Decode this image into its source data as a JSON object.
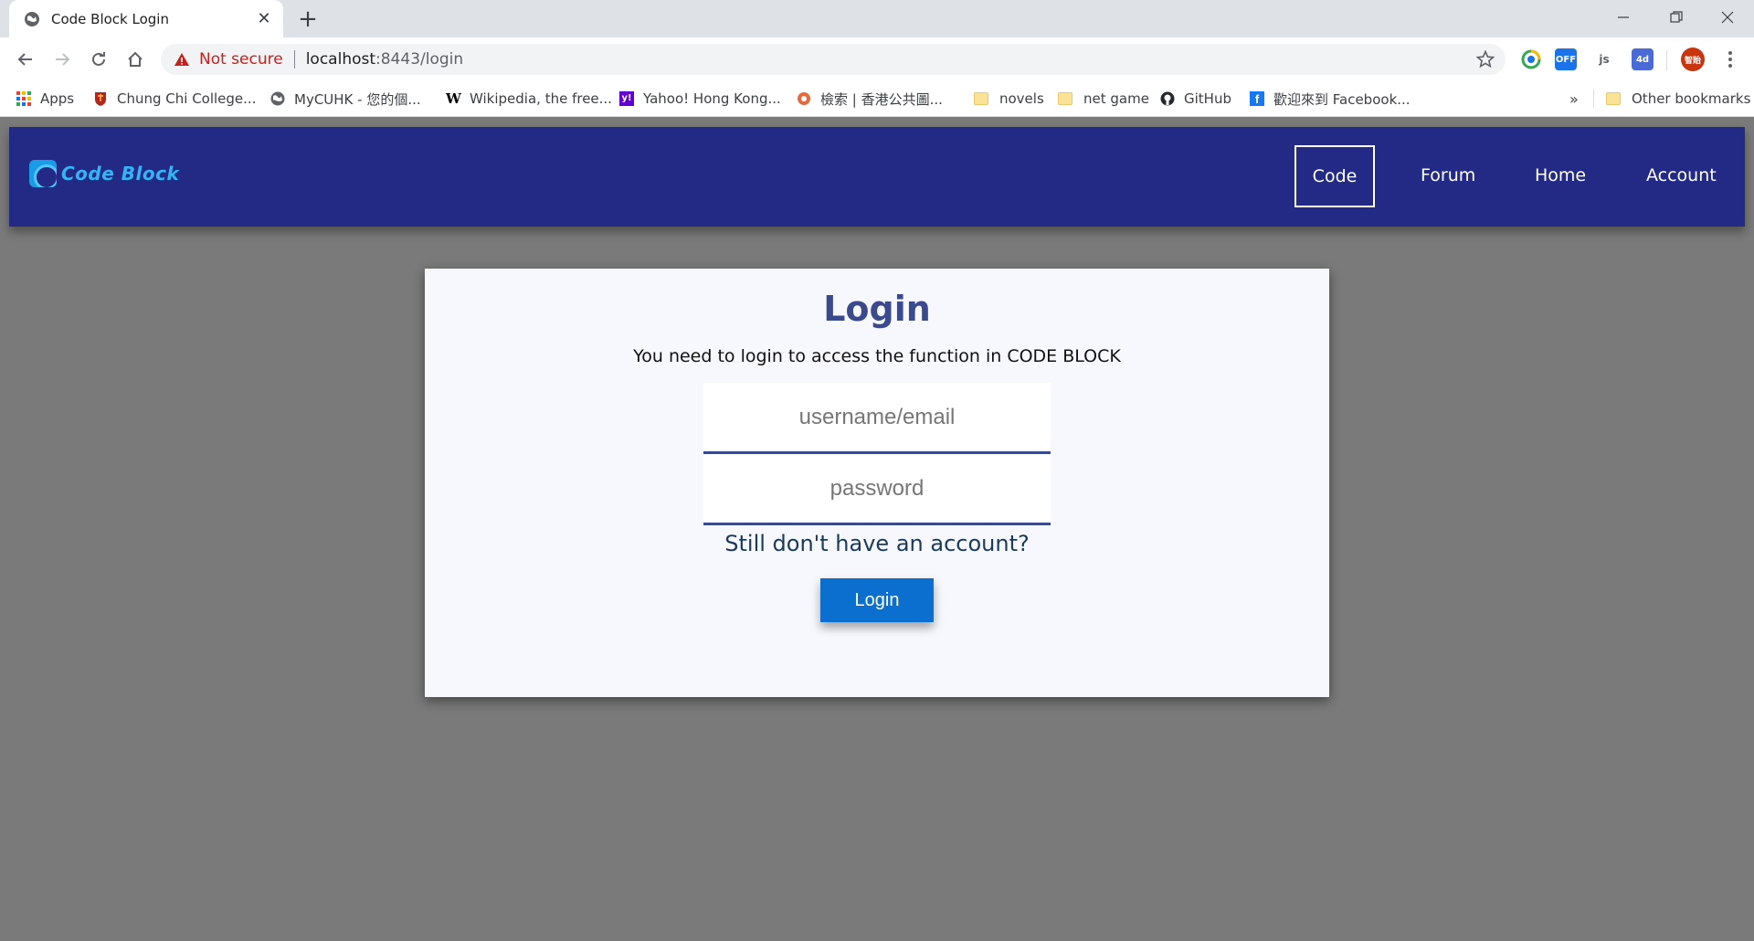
{
  "browser": {
    "tab_title": "Code Block Login",
    "new_tab_label": "+",
    "omnibox": {
      "security_label": "Not secure",
      "host": "localhost",
      "rest": ":8443/login"
    },
    "bookmarks": [
      {
        "label": "Apps",
        "icon": "apps-grid-icon"
      },
      {
        "label": "Chung Chi College...",
        "icon": "college-crest-icon"
      },
      {
        "label": "MyCUHK - 您的個...",
        "icon": "globe-icon"
      },
      {
        "label": "Wikipedia, the free...",
        "icon": "wikipedia-icon"
      },
      {
        "label": "Yahoo! Hong Kong...",
        "icon": "yahoo-icon"
      },
      {
        "label": "檢索 | 香港公共圖...",
        "icon": "hkpl-icon"
      },
      {
        "label": "novels",
        "icon": "folder-icon"
      },
      {
        "label": "net game",
        "icon": "folder-icon"
      },
      {
        "label": "GitHub",
        "icon": "github-icon"
      },
      {
        "label": "歡迎來到 Facebook...",
        "icon": "facebook-icon"
      }
    ],
    "bookmarks_overflow": "»",
    "other_bookmarks": "Other bookmarks",
    "extensions": [
      {
        "name": "chrome-extension-green",
        "color": "#34a853"
      },
      {
        "name": "off-extension",
        "label": "OFF",
        "color": "#1a73e8"
      },
      {
        "name": "js-extension",
        "label": "js",
        "color": "#9aa0a6"
      },
      {
        "name": "4d-extension",
        "label": "4d",
        "color": "#4a6bd6"
      },
      {
        "name": "profile-avatar",
        "label": "智貽",
        "color": "#c8350f"
      }
    ]
  },
  "app": {
    "brand": "Code Block",
    "nav": [
      {
        "label": "Code",
        "active": true
      },
      {
        "label": "Forum"
      },
      {
        "label": "Home"
      },
      {
        "label": "Account"
      }
    ],
    "login": {
      "title": "Login",
      "subtitle": "You need to login to access the function in CODE BLOCK",
      "username_placeholder": "username/email",
      "password_placeholder": "password",
      "signup_link": "Still don't have an account?",
      "button_label": "Login"
    }
  },
  "colors": {
    "navbar": "#222a86",
    "brand_text": "#35b4f5",
    "title": "#3b4a8c",
    "button": "#0a6fce",
    "backdrop": "#7a7a7a",
    "card": "#f7f8fd"
  }
}
